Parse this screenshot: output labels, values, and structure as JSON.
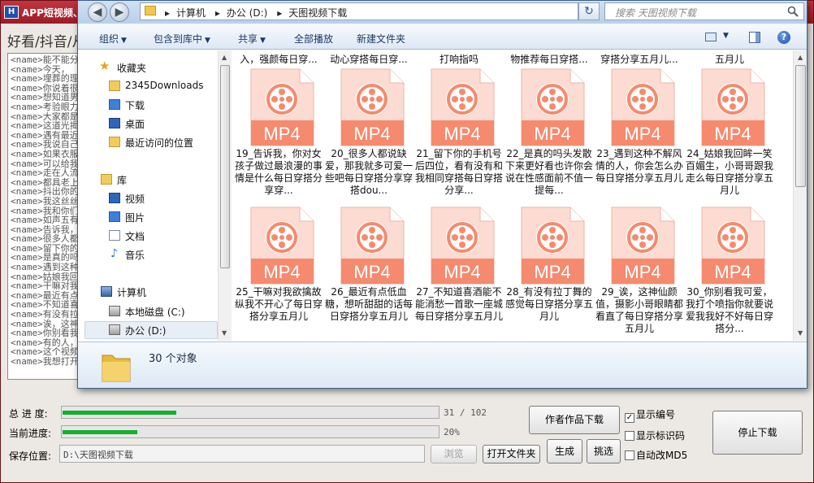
{
  "app": {
    "logo": "H",
    "title": "APP短视频、",
    "category": "好看/抖音/从",
    "name_list": [
      "<name>能不能分",
      "<name>今天，",
      "<name>埋葬的理",
      "<name>你说着很",
      "<name>想知道男",
      "<name>考验眼力",
      "<name>大家都是",
      "<name>这道光揭",
      "<name>遇有最近",
      "<name>我说自己",
      "<name>如果衣服",
      "<name>可以给我",
      "<name>走在人流",
      "<name>都具老上",
      "<name>抖出你的",
      "<name>我这丝丝",
      "<name>我和你们",
      "<name>如声五有",
      "<name>告诉我，",
      "<name>很多人都",
      "<name>留下你的",
      "<name>是真的吗",
      "<name>遇到这种",
      "<name>姑娘我回",
      "<name>干嘛对我",
      "<name>最近有点",
      "<name>不知道喜",
      "<name>有没有拉",
      "<name>诶，这神",
      "<name>你别看我",
      "<name>有的人，",
      "<name>这个视频",
      "<name>我想打开"
    ],
    "total_progress": {
      "label": "总 进 度:",
      "done": 31,
      "total": 102,
      "text": "31 / 102",
      "fraction": 0.3039
    },
    "current_progress": {
      "label": "当前进度:",
      "percent": 20,
      "text": "20%"
    },
    "save_location": {
      "label": "保存位置:",
      "value": "D:\\天图视频下载"
    },
    "buttons": {
      "browse": "浏览",
      "open_folder": "打开文件夹",
      "author_download": "作者作品下载",
      "generate": "生成",
      "select": "挑选",
      "stop_download": "停止下载"
    },
    "checkboxes": [
      {
        "label": "显示编号",
        "checked": true
      },
      {
        "label": "显示标识码",
        "checked": false
      },
      {
        "label": "自动改MD5",
        "checked": false
      }
    ]
  },
  "explorer": {
    "address_path": [
      "计算机",
      "办公 (D:)",
      "天图视频下载"
    ],
    "search_placeholder": "搜索 天图视频下载",
    "toolbar": {
      "organize": "组织",
      "include_in_library": "包含到库中",
      "share": "共享",
      "play_all": "全部播放",
      "new_folder": "新建文件夹"
    },
    "nav": {
      "favorites": "收藏夹",
      "downloads_2345": "2345Downloads",
      "downloads": "下载",
      "desktop": "桌面",
      "recent": "最近访问的位置",
      "libraries": "库",
      "videos": "视频",
      "pictures": "图片",
      "documents": "文档",
      "music": "音乐",
      "computer": "计算机",
      "local_c": "本地磁盘 (C:)",
      "office_d": "办公 (D:)"
    },
    "partial_row": [
      "入，强颜每日穿...",
      "动心穿搭每日穿...",
      "打响指吗",
      "物推荐每日穿搭...",
      "穿搭分享五月儿...",
      "五月儿"
    ],
    "file_badge": "MP4",
    "files": [
      "19_告诉我，你对女孩子做过最浪漫的事情是什么每日穿搭分享穿...",
      "20_很多人都说缺爱，那我就多可爱一些吧每日穿搭分享穿搭dou...",
      "21_留下你的手机号后四位，看有没有和我相同穿搭每日穿搭分享...",
      "22_是真的吗头发散下来更好看也许你会说在性感面前不值一提每...",
      "23_遇到这种不解风情的人，你会怎么办每日穿搭分享五月儿",
      "24_姑娘我回眸一笑百媚生，小哥哥跟我走么每日穿搭分享五月儿",
      "25_干嘛对我欲擒故纵我不开心了每日穿搭分享五月儿",
      "26_最近有点低血糖，想听甜甜的话每日穿搭分享五月儿",
      "27_不知道喜酒能不能消愁一首歌一座城每日穿搭分享五月儿",
      "28_有没有拉丁舞的感觉每日穿搭分享五月儿",
      "29_诶，这神仙颜值，摄影小哥眼睛都看直了每日穿搭分享五月儿",
      "30_你别看我可爱，我打个喷指你就要说爱我我好不好每日穿搭分..."
    ],
    "status_count": "30 个对象"
  },
  "colors": {
    "app_title_bar": "#b02a33",
    "progress_green": "#12b02c",
    "mp4_orange": "#f58a6e",
    "mp4_light": "#fcdcd2"
  }
}
